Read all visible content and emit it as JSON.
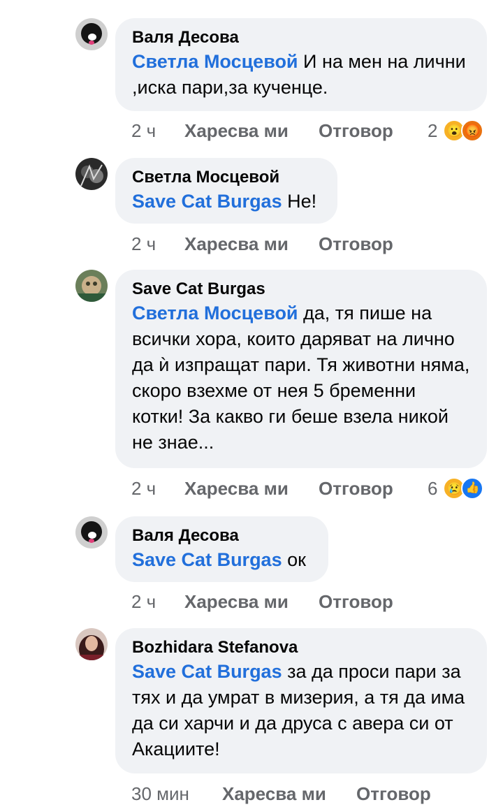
{
  "comments": [
    {
      "author": "Валя Десова",
      "mention": "Светла Мосцевой",
      "text": " И на мен на лични ,иска пари,за кученце.",
      "time": "2 ч",
      "like_label": "Харесва ми",
      "reply_label": "Отговор",
      "reaction_count": "2",
      "reactions": [
        "wow-icon",
        "angry-icon"
      ]
    },
    {
      "author": "Светла Мосцевой",
      "mention": "Save Cat Burgas",
      "text": " Не!",
      "time": "2 ч",
      "like_label": "Харесва ми",
      "reply_label": "Отговор"
    },
    {
      "author": "Save Cat Burgas",
      "mention": "Светла Мосцевой",
      "text": " да, тя пише на всички хора, които даряват на лично да ѝ изпращат пари. Тя животни няма, скоро взехме от нея 5 бременни котки! За какво ги беше взела никой не знае...",
      "time": "2 ч",
      "like_label": "Харесва ми",
      "reply_label": "Отговор",
      "reaction_count": "6",
      "reactions": [
        "sad-icon",
        "like-icon"
      ]
    },
    {
      "author": "Валя Десова",
      "mention": "Save Cat Burgas",
      "text": " ок",
      "time": "2 ч",
      "like_label": "Харесва ми",
      "reply_label": "Отговор"
    },
    {
      "author": "Bozhidara Stefanova",
      "mention": "Save Cat Burgas",
      "text": " за да проси пари за тях и да умрат в мизерия, а тя да има да си харчи и да друса с авера си от Акациите!",
      "time": "30 мин",
      "like_label": "Харесва ми",
      "reply_label": "Отговор"
    }
  ],
  "colors": {
    "mention": "#216fdb",
    "bubble": "#f0f2f5",
    "meta": "#65676b"
  }
}
